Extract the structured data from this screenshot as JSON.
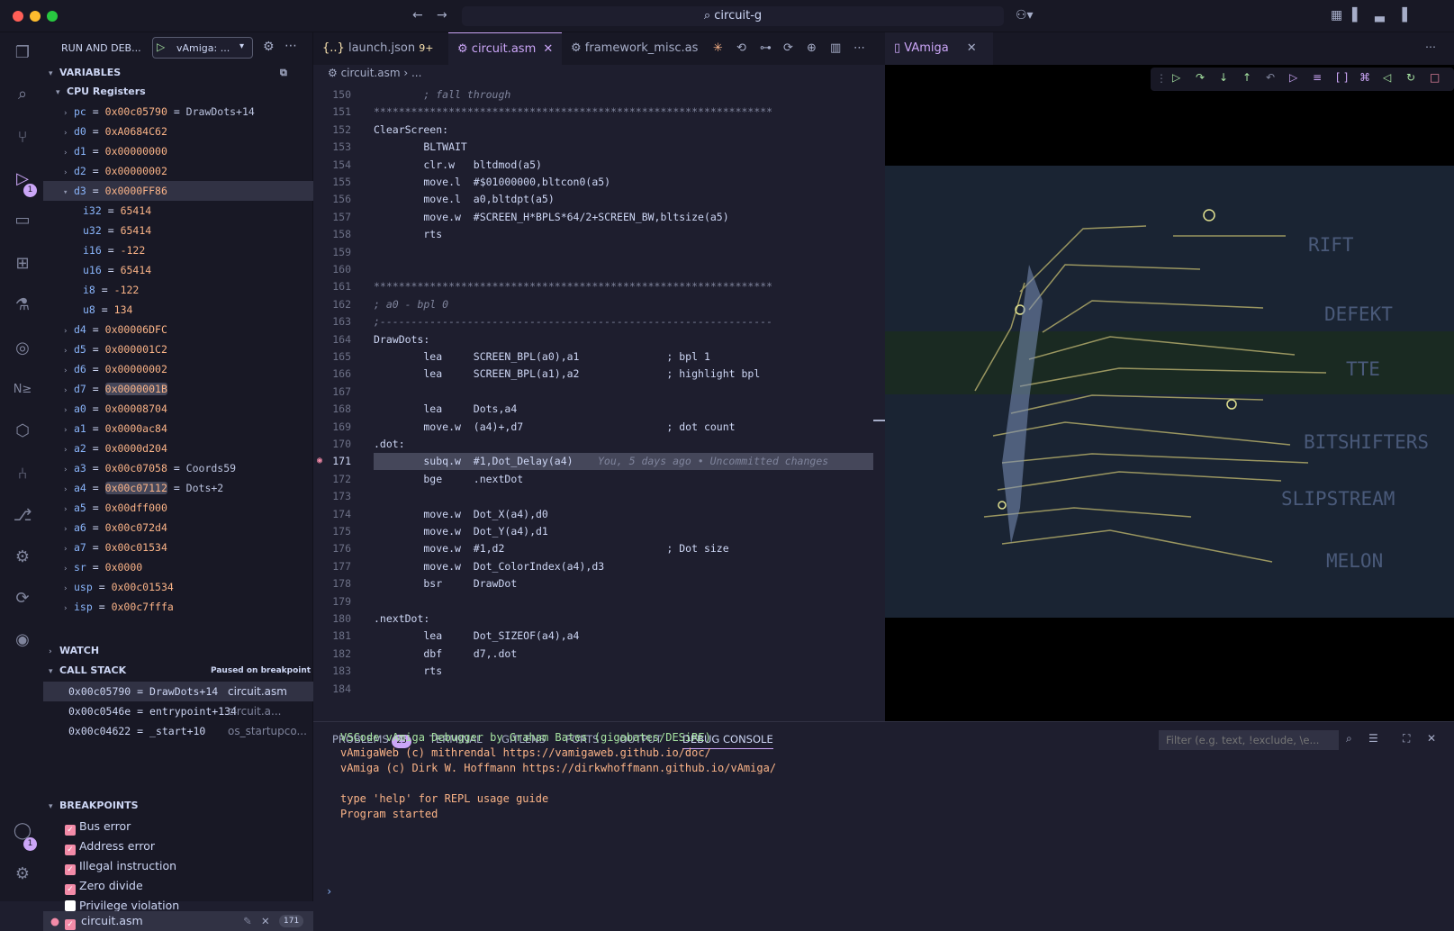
{
  "window": {
    "search_text": "circuit-g"
  },
  "sidebar": {
    "title": "RUN AND DEB...",
    "config": "vAmiga: ...",
    "variables_label": "VARIABLES",
    "cpu_label": "CPU Registers",
    "registers": [
      {
        "name": "pc",
        "value": "0x00c05790",
        "sym": "DrawDots+14"
      },
      {
        "name": "d0",
        "value": "0xA0684C62"
      },
      {
        "name": "d1",
        "value": "0x00000000"
      },
      {
        "name": "d2",
        "value": "0x00000002"
      },
      {
        "name": "d3",
        "value": "0x0000FF86"
      },
      {
        "name": "i32",
        "value": "65414"
      },
      {
        "name": "u32",
        "value": "65414"
      },
      {
        "name": "i16",
        "value": "-122"
      },
      {
        "name": "u16",
        "value": "65414"
      },
      {
        "name": "i8",
        "value": "-122"
      },
      {
        "name": "u8",
        "value": "134"
      },
      {
        "name": "d4",
        "value": "0x00006DFC"
      },
      {
        "name": "d5",
        "value": "0x000001C2"
      },
      {
        "name": "d6",
        "value": "0x00000002"
      },
      {
        "name": "d7",
        "value": "0x0000001B"
      },
      {
        "name": "a0",
        "value": "0x00008704"
      },
      {
        "name": "a1",
        "value": "0x0000ac84"
      },
      {
        "name": "a2",
        "value": "0x0000d204"
      },
      {
        "name": "a3",
        "value": "0x00c07058",
        "sym": "Coords59"
      },
      {
        "name": "a4",
        "value": "0x00c07112",
        "sym": "Dots+2"
      },
      {
        "name": "a5",
        "value": "0x00dff000"
      },
      {
        "name": "a6",
        "value": "0x00c072d4"
      },
      {
        "name": "a7",
        "value": "0x00c01534"
      },
      {
        "name": "sr",
        "value": "0x0000"
      },
      {
        "name": "usp",
        "value": "0x00c01534"
      },
      {
        "name": "isp",
        "value": "0x00c7fffa"
      }
    ],
    "watch_label": "WATCH",
    "callstack_label": "CALL STACK",
    "paused_label": "Paused on breakpoint",
    "callstack": [
      {
        "addr": "0x00c05790",
        "sym": "DrawDots+14",
        "file": "circuit.asm"
      },
      {
        "addr": "0x00c0546e",
        "sym": "entrypoint+134",
        "file": "circuit.a..."
      },
      {
        "addr": "0x00c04622",
        "sym": "_start+10",
        "file": "os_startupco..."
      }
    ],
    "breakpoints_label": "BREAKPOINTS",
    "breakpoints": [
      "Bus error",
      "Address error",
      "Illegal instruction",
      "Zero divide",
      "Privilege violation"
    ],
    "bp_file": "circuit.asm",
    "bp_line": "171"
  },
  "editor": {
    "tabs": [
      {
        "label": "launch.json",
        "extra": "9+"
      },
      {
        "label": "circuit.asm"
      },
      {
        "label": "framework_misc.asm"
      }
    ],
    "breadcrumb": "circuit.asm",
    "breadcrumb_more": "...",
    "vamiga_tab": "VAmiga",
    "lines": [
      {
        "n": "150",
        "t": "        ; fall through"
      },
      {
        "n": "151",
        "t": "****************************************************************"
      },
      {
        "n": "152",
        "t": "ClearScreen:"
      },
      {
        "n": "153",
        "t": "        BLTWAIT"
      },
      {
        "n": "154",
        "t": "        clr.w   bltdmod(a5)"
      },
      {
        "n": "155",
        "t": "        move.l  #$01000000,bltcon0(a5)"
      },
      {
        "n": "156",
        "t": "        move.l  a0,bltdpt(a5)"
      },
      {
        "n": "157",
        "t": "        move.w  #SCREEN_H*BPLS*64/2+SCREEN_BW,bltsize(a5)"
      },
      {
        "n": "158",
        "t": "        rts"
      },
      {
        "n": "159",
        "t": ""
      },
      {
        "n": "160",
        "t": ""
      },
      {
        "n": "161",
        "t": "****************************************************************"
      },
      {
        "n": "162",
        "t": "; a0 - bpl 0"
      },
      {
        "n": "163",
        "t": ";---------------------------------------------------------------"
      },
      {
        "n": "164",
        "t": "DrawDots:"
      },
      {
        "n": "165",
        "t": "        lea     SCREEN_BPL(a0),a1              ; bpl 1"
      },
      {
        "n": "166",
        "t": "        lea     SCREEN_BPL(a1),a2              ; highlight bpl"
      },
      {
        "n": "167",
        "t": ""
      },
      {
        "n": "168",
        "t": "        lea     Dots,a4"
      },
      {
        "n": "169",
        "t": "        move.w  (a4)+,d7                       ; dot count"
      },
      {
        "n": "170",
        "t": ".dot:"
      },
      {
        "n": "171",
        "t": "        subq.w  #1,Dot_Delay(a4)"
      },
      {
        "n": "172",
        "t": "        bge     .nextDot"
      },
      {
        "n": "173",
        "t": ""
      },
      {
        "n": "174",
        "t": "        move.w  Dot_X(a4),d0"
      },
      {
        "n": "175",
        "t": "        move.w  Dot_Y(a4),d1"
      },
      {
        "n": "176",
        "t": "        move.w  #1,d2                          ; Dot size"
      },
      {
        "n": "177",
        "t": "        move.w  Dot_ColorIndex(a4),d3"
      },
      {
        "n": "178",
        "t": "        bsr     DrawDot"
      },
      {
        "n": "179",
        "t": ""
      },
      {
        "n": "180",
        "t": ".nextDot:"
      },
      {
        "n": "181",
        "t": "        lea     Dot_SIZEOF(a4),a4"
      },
      {
        "n": "182",
        "t": "        dbf     d7,.dot"
      },
      {
        "n": "183",
        "t": "        rts"
      },
      {
        "n": "184",
        "t": ""
      }
    ],
    "blame": "You, 5 days ago • Uncommitted changes"
  },
  "vamiga_names": [
    "RIFT",
    "DEFEKT",
    "TTE",
    "BITSHIFTERS",
    "SLIPSTREAM",
    "MELON"
  ],
  "panel": {
    "tabs": [
      "PROBLEMS",
      "TERMINAL",
      "GITLENS",
      "PORTS",
      "OUTPUT",
      "DEBUG CONSOLE"
    ],
    "problems_count": "25",
    "filter_placeholder": "Filter (e.g. text, !exclude, \\e...",
    "console": [
      "VSCode vAmiga Debugger by Graham Bates (gigabates/DESiRE)",
      "vAmigaWeb (c) mithrendal https://vamigaweb.github.io/doc/",
      "vAmiga (c) Dirk W. Hoffmann https://dirkwhoffmann.github.io/vAmiga/",
      "",
      "type 'help' for REPL usage guide",
      "Program started"
    ]
  },
  "colors": {
    "accent": "#cba6f7",
    "breakpoint": "#f38ba8",
    "console_green": "#a6e3a1",
    "console_orange": "#fab387"
  }
}
